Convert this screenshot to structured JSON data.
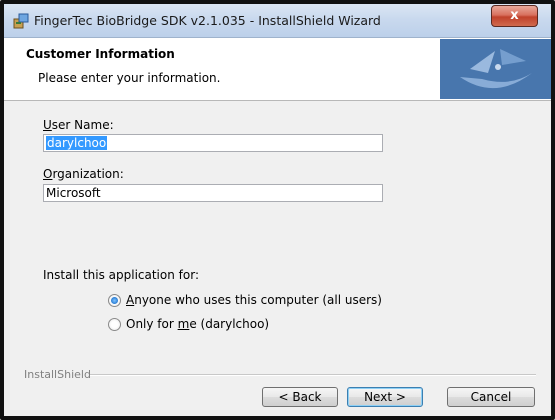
{
  "window": {
    "title": "FingerTec BioBridge SDK v2.1.035 - InstallShield Wizard",
    "close_glyph": "x"
  },
  "header": {
    "title": "Customer Information",
    "subtitle": "Please enter your information."
  },
  "form": {
    "user_name_label": "User Name:",
    "user_name_value": "darylchoo",
    "organization_label": "Organization:",
    "organization_value": "Microsoft"
  },
  "install_for": {
    "label": "Install this application for:",
    "options": [
      {
        "label": "Anyone who uses this computer (all users)",
        "selected": true
      },
      {
        "label": "Only for me (darylchoo)",
        "selected": false
      }
    ]
  },
  "footer": {
    "brand": "InstallShield",
    "back_label": "< Back",
    "next_label": "Next >",
    "cancel_label": "Cancel"
  },
  "colors": {
    "selection": "#3399ff",
    "titlebar": "#c9d9ee",
    "logo_bg": "#3c6aa0"
  }
}
